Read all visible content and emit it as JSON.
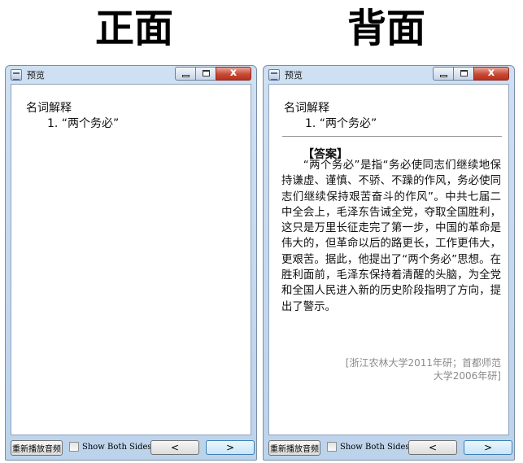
{
  "labels": {
    "front": "正面",
    "back": "背面"
  },
  "window": {
    "title": "预览",
    "close_glyph": "x"
  },
  "card": {
    "word": "名词解释",
    "prompt": "1. “两个务必”",
    "answer_heading": "【答案】",
    "answer_text": "“两个务必”是指“务必使同志们继续地保持谦虚、谨慎、不骄、不躁的作风，务必使同志们继续保持艰苦奋斗的作风”。中共七届二中全会上，毛泽东告诫全党，夺取全国胜利，这只是万里长征走完了第一步，中国的革命是伟大的，但革命以后的路更长，工作更伟大，更艰苦。据此，他提出了“两个务必”思想。在胜利面前，毛泽东保持着清醒的头脑，为全党和全国人民进入新的历史阶段指明了方向，提出了警示。",
    "source": "[浙江农林大学2011年研；首都师范大学2006年研]"
  },
  "bottom": {
    "replay_label": "重新播放音频",
    "show_both_label": "Show Both Sides",
    "show_both_checked": false,
    "prev_label": "<",
    "next_label": ">"
  },
  "colors": {
    "frame": "#bcd3ec",
    "close_button": "#c74a36",
    "divider": "#909090",
    "source_text": "#8a8a8a"
  },
  "icons": [
    "app-icon",
    "minimize-icon",
    "maximize-icon",
    "close-icon"
  ]
}
